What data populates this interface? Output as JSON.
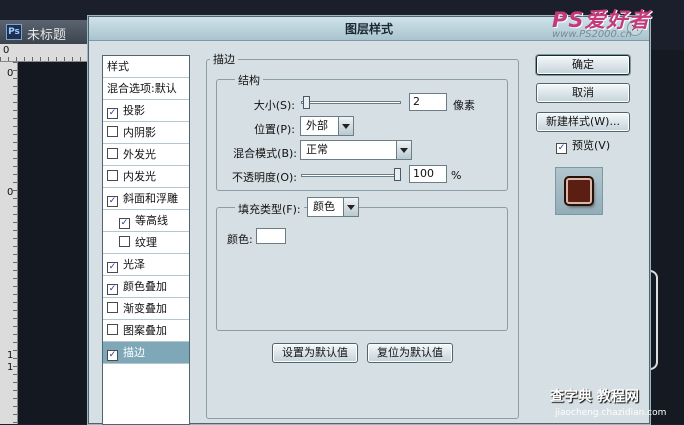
{
  "background_window": {
    "app_icon_text": "Ps",
    "doc_title": "未标题",
    "ruler_top_number": "0",
    "ruler_left_numbers": [
      "0",
      "0",
      "1",
      "1"
    ]
  },
  "dialog": {
    "title": "图层样式",
    "close_glyph": "×"
  },
  "styles_list": {
    "header": "样式",
    "blend_options": "混合选项:默认",
    "items": [
      {
        "label": "投影",
        "checked": true,
        "indent": false
      },
      {
        "label": "内阴影",
        "checked": false,
        "indent": false
      },
      {
        "label": "外发光",
        "checked": false,
        "indent": false
      },
      {
        "label": "内发光",
        "checked": false,
        "indent": false
      },
      {
        "label": "斜面和浮雕",
        "checked": true,
        "indent": false
      },
      {
        "label": "等高线",
        "checked": true,
        "indent": true
      },
      {
        "label": "纹理",
        "checked": false,
        "indent": true
      },
      {
        "label": "光泽",
        "checked": true,
        "indent": false
      },
      {
        "label": "颜色叠加",
        "checked": true,
        "indent": false
      },
      {
        "label": "渐变叠加",
        "checked": false,
        "indent": false
      },
      {
        "label": "图案叠加",
        "checked": false,
        "indent": false
      },
      {
        "label": "描边",
        "checked": true,
        "indent": false,
        "selected": true
      }
    ]
  },
  "stroke": {
    "section_title": "描边",
    "structure_title": "结构",
    "size_label": "大小(S):",
    "size_value": "2",
    "size_unit": "像素",
    "size_level": 0.02,
    "position_label": "位置(P):",
    "position_value": "外部",
    "blend_mode_label": "混合模式(B):",
    "blend_mode_value": "正常",
    "opacity_label": "不透明度(O):",
    "opacity_value": "100",
    "opacity_unit": "%",
    "opacity_level": 1.0,
    "fill_type_label": "填充类型(F):",
    "fill_type_value": "颜色",
    "color_label": "颜色:",
    "color_value": "#ffffff"
  },
  "bottom_buttons": {
    "set_default": "设置为默认值",
    "reset_default": "复位为默认值"
  },
  "right_buttons": {
    "ok": "确定",
    "cancel": "取消",
    "new_style": "新建样式(W)...",
    "preview_label": "预览(V)",
    "preview_checked": true
  },
  "watermarks": {
    "top_logo": "PS爱好者",
    "top_url": "www.PS2000.cn",
    "bottom_logo": "查字典 教程网",
    "bottom_url": "jiaocheng.chazidian.com"
  }
}
